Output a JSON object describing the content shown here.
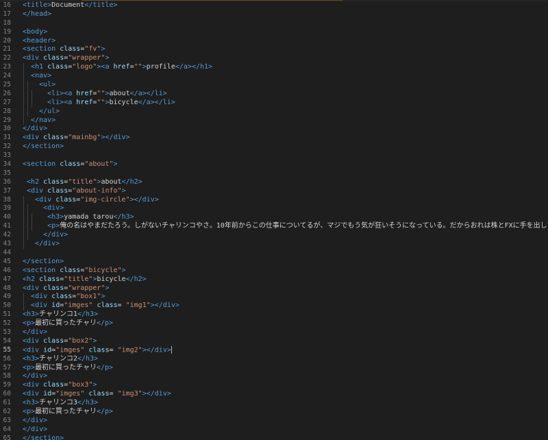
{
  "editor": {
    "colors": {
      "background": "#1e1e1e",
      "tag": "#569cd6",
      "attribute": "#9cdcfe",
      "string": "#ce9178",
      "text": "#d4d4d4",
      "line_number": "#858585"
    },
    "active_line": 55,
    "lines": [
      {
        "n": 16,
        "indent": 0,
        "html": "<span class=\"tag\">&lt;title&gt;</span><span class=\"plain\">Document</span><span class=\"tag\">&lt;/title&gt;</span>"
      },
      {
        "n": 17,
        "indent": 0,
        "html": "<span class=\"tag\">&lt;/head&gt;</span>"
      },
      {
        "n": 18,
        "indent": 0,
        "html": ""
      },
      {
        "n": 19,
        "indent": 0,
        "html": "<span class=\"tag\">&lt;body&gt;</span>"
      },
      {
        "n": 20,
        "indent": 0,
        "html": "<span class=\"tag\">&lt;header&gt;</span>"
      },
      {
        "n": 21,
        "indent": 0,
        "html": "<span class=\"tag\">&lt;section</span> <span class=\"attr\">class</span><span class=\"plain\">=</span><span class=\"str\">\"fv\"</span><span class=\"tag\">&gt;</span>"
      },
      {
        "n": 22,
        "indent": 0,
        "html": "<span class=\"tag\">&lt;div</span> <span class=\"attr\">class</span><span class=\"plain\">=</span><span class=\"str\">\"wrapper\"</span><span class=\"tag\">&gt;</span>"
      },
      {
        "n": 23,
        "indent": 1,
        "html": "  <span class=\"tag\">&lt;h1</span> <span class=\"attr\">class</span><span class=\"plain\">=</span><span class=\"str\">\"logo\"</span><span class=\"tag\">&gt;&lt;a</span> <span class=\"attr\">href</span><span class=\"plain\">=</span><span class=\"str\">\"\"</span><span class=\"tag\">&gt;</span><span class=\"plain\">profile</span><span class=\"tag\">&lt;/a&gt;&lt;/h1&gt;</span>"
      },
      {
        "n": 24,
        "indent": 1,
        "html": "  <span class=\"tag\">&lt;nav&gt;</span>"
      },
      {
        "n": 25,
        "indent": 2,
        "html": "    <span class=\"tag\">&lt;ul&gt;</span>"
      },
      {
        "n": 26,
        "indent": 3,
        "html": "      <span class=\"tag\">&lt;li&gt;&lt;a</span> <span class=\"attr\">href</span><span class=\"plain\">=</span><span class=\"str\">\"\"</span><span class=\"tag\">&gt;</span><span class=\"plain\">about</span><span class=\"tag\">&lt;/a&gt;&lt;/li&gt;</span>"
      },
      {
        "n": 27,
        "indent": 3,
        "html": "      <span class=\"tag\">&lt;li&gt;&lt;a</span> <span class=\"attr\">href</span><span class=\"plain\">=</span><span class=\"str\">\"\"</span><span class=\"tag\">&gt;</span><span class=\"plain\">bicycle</span><span class=\"tag\">&lt;/a&gt;&lt;/li&gt;</span>"
      },
      {
        "n": 28,
        "indent": 2,
        "html": "    <span class=\"tag\">&lt;/ul&gt;</span>"
      },
      {
        "n": 29,
        "indent": 1,
        "html": "  <span class=\"tag\">&lt;/nav&gt;</span>"
      },
      {
        "n": 30,
        "indent": 0,
        "html": "<span class=\"tag\">&lt;/div&gt;</span>"
      },
      {
        "n": 31,
        "indent": 0,
        "html": "<span class=\"tag\">&lt;div</span> <span class=\"attr\">class</span><span class=\"plain\">=</span><span class=\"str\">\"mainbg\"</span><span class=\"tag\">&gt;&lt;/div&gt;</span>"
      },
      {
        "n": 32,
        "indent": 0,
        "html": "<span class=\"tag\">&lt;/section&gt;</span>"
      },
      {
        "n": 33,
        "indent": 0,
        "html": ""
      },
      {
        "n": 34,
        "indent": 0,
        "html": "<span class=\"tag\">&lt;section</span> <span class=\"attr\">class</span><span class=\"plain\">=</span><span class=\"str\">\"about\"</span><span class=\"tag\">&gt;</span>"
      },
      {
        "n": 35,
        "indent": 0,
        "html": ""
      },
      {
        "n": 36,
        "indent": 0,
        "html": " <span class=\"tag\">&lt;h2</span> <span class=\"attr\">class</span><span class=\"plain\">=</span><span class=\"str\">\"title\"</span><span class=\"tag\">&gt;</span><span class=\"plain\">about</span><span class=\"tag\">&lt;/h2&gt;</span>"
      },
      {
        "n": 37,
        "indent": 0,
        "html": " <span class=\"tag\">&lt;div</span> <span class=\"attr\">class</span><span class=\"plain\">=</span><span class=\"str\">\"about-info\"</span><span class=\"tag\">&gt;</span>"
      },
      {
        "n": 38,
        "indent": 1,
        "html": "   <span class=\"tag\">&lt;div</span> <span class=\"attr\">class</span><span class=\"plain\">=</span><span class=\"str\">\"img-circle\"</span><span class=\"tag\">&gt;&lt;/div&gt;</span>"
      },
      {
        "n": 39,
        "indent": 2,
        "html": "     <span class=\"tag\">&lt;div&gt;</span>"
      },
      {
        "n": 40,
        "indent": 3,
        "html": "      <span class=\"tag\">&lt;h3&gt;</span><span class=\"plain\">yamada tarou</span><span class=\"tag\">&lt;/h3&gt;</span>"
      },
      {
        "n": 41,
        "indent": 3,
        "html": "      <span class=\"tag\">&lt;p&gt;</span><span class=\"plain\">俺の名はやまだたろう。しがないチャリンコやさ。10年前からこの仕事についてるが、マジでもう気が狂いそうになっている。だからおれは株とFXに手を出したのさ。</span><span class=\"tag\">&lt;/p</span>"
      },
      {
        "n": 42,
        "indent": 2,
        "html": "     <span class=\"tag\">&lt;/div&gt;</span>"
      },
      {
        "n": 43,
        "indent": 1,
        "html": "   <span class=\"tag\">&lt;/div&gt;</span>"
      },
      {
        "n": 44,
        "indent": 0,
        "html": ""
      },
      {
        "n": 45,
        "indent": 0,
        "html": "<span class=\"tag\">&lt;/section&gt;</span>"
      },
      {
        "n": 46,
        "indent": 0,
        "html": "<span class=\"tag\">&lt;section</span> <span class=\"attr\">class</span><span class=\"plain\">=</span><span class=\"str\">\"bicycle\"</span><span class=\"tag\">&gt;</span>"
      },
      {
        "n": 47,
        "indent": 0,
        "html": "<span class=\"tag\">&lt;h2</span> <span class=\"attr\">class</span><span class=\"plain\">=</span><span class=\"str\">\"title\"</span><span class=\"tag\">&gt;</span><span class=\"plain\">bicycle</span><span class=\"tag\">&lt;/h2&gt;</span>"
      },
      {
        "n": 48,
        "indent": 0,
        "html": "<span class=\"tag\">&lt;div</span> <span class=\"attr\">class</span><span class=\"plain\">=</span><span class=\"str\">\"wrapper\"</span><span class=\"tag\">&gt;</span>"
      },
      {
        "n": 49,
        "indent": 1,
        "html": "  <span class=\"tag\">&lt;div</span> <span class=\"attr\">class</span><span class=\"plain\">=</span><span class=\"str\">\"box1\"</span><span class=\"tag\">&gt;</span>"
      },
      {
        "n": 50,
        "indent": 1,
        "html": "  <span class=\"tag\">&lt;div</span> <span class=\"attr\">id</span><span class=\"plain\">=</span><span class=\"str\">\"imges\"</span> <span class=\"attr\">class</span><span class=\"plain\">=</span> <span class=\"str\">\"img1\"</span><span class=\"tag\">&gt;&lt;/div&gt;</span>"
      },
      {
        "n": 51,
        "indent": 0,
        "html": "<span class=\"tag\">&lt;h3&gt;</span><span class=\"plain\">チャリンコ1</span><span class=\"tag\">&lt;/h3&gt;</span>"
      },
      {
        "n": 52,
        "indent": 0,
        "html": "<span class=\"tag\">&lt;p&gt;</span><span class=\"plain\">最初に買ったチャリ</span><span class=\"tag\">&lt;/p&gt;</span>"
      },
      {
        "n": 53,
        "indent": 0,
        "html": "<span class=\"tag\">&lt;/div&gt;</span>"
      },
      {
        "n": 54,
        "indent": 0,
        "html": "<span class=\"tag\">&lt;div</span> <span class=\"attr\">class</span><span class=\"plain\">=</span><span class=\"str\">\"box2\"</span><span class=\"tag\">&gt;</span>"
      },
      {
        "n": 55,
        "indent": 0,
        "html": "<span class=\"tag\">&lt;div</span> <span class=\"attr\">id</span><span class=\"plain\">=</span><span class=\"str\">\"imges\"</span> <span class=\"attr\">class</span><span class=\"plain\">=</span> <span class=\"str\">\"img2\"</span><span class=\"tag\">&gt;&lt;/div&gt;</span><span class=\"cursor\"></span>"
      },
      {
        "n": 56,
        "indent": 0,
        "html": "<span class=\"tag\">&lt;h3&gt;</span><span class=\"plain\">チャリンコ2</span><span class=\"tag\">&lt;/h3&gt;</span>"
      },
      {
        "n": 57,
        "indent": 0,
        "html": "<span class=\"tag\">&lt;p&gt;</span><span class=\"plain\">最初に買ったチャリ</span><span class=\"tag\">&lt;/p&gt;</span>"
      },
      {
        "n": 58,
        "indent": 0,
        "html": "<span class=\"tag\">&lt;/div&gt;</span>"
      },
      {
        "n": 59,
        "indent": 0,
        "html": "<span class=\"tag\">&lt;div</span> <span class=\"attr\">class</span><span class=\"plain\">=</span><span class=\"str\">\"box3\"</span><span class=\"tag\">&gt;</span>"
      },
      {
        "n": 60,
        "indent": 0,
        "html": "<span class=\"tag\">&lt;div</span> <span class=\"attr\">id</span><span class=\"plain\">=</span><span class=\"str\">\"imges\"</span> <span class=\"attr\">class</span><span class=\"plain\">=</span> <span class=\"str\">\"img3\"</span><span class=\"tag\">&gt;&lt;/div&gt;</span>"
      },
      {
        "n": 61,
        "indent": 0,
        "html": "<span class=\"tag\">&lt;h3&gt;</span><span class=\"plain\">チャリンコ3</span><span class=\"tag\">&lt;/h3&gt;</span>"
      },
      {
        "n": 62,
        "indent": 0,
        "html": "<span class=\"tag\">&lt;p&gt;</span><span class=\"plain\">最初に買ったチャリ</span><span class=\"tag\">&lt;/p&gt;</span>"
      },
      {
        "n": 63,
        "indent": 0,
        "html": "<span class=\"tag\">&lt;/div&gt;</span>"
      },
      {
        "n": 64,
        "indent": 0,
        "html": "<span class=\"tag\">&lt;/div&gt;</span>"
      },
      {
        "n": 65,
        "indent": 0,
        "html": "<span class=\"tag\">&lt;/section&gt;</span>"
      }
    ]
  }
}
